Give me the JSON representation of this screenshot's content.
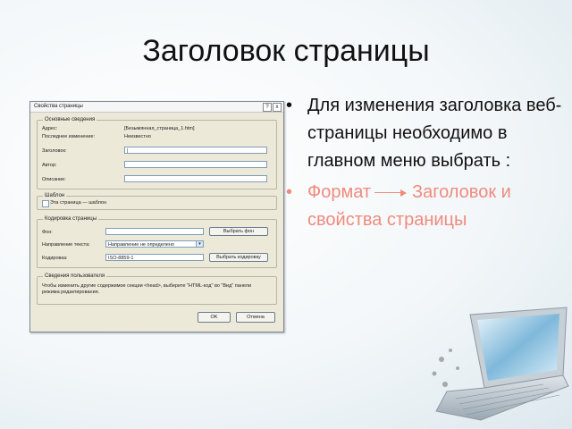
{
  "slide": {
    "title": "Заголовок страницы",
    "bullet1": "Для изменения заголовка веб-страницы необходимо в главном меню выбрать :",
    "bullet2_part1": "Формат",
    "bullet2_part2": "Заголовок и свойства страницы"
  },
  "dialog": {
    "title": "Свойства страницы",
    "help_button": "?",
    "close_button": "x",
    "group_general": {
      "label": "Основные сведения",
      "rows": [
        {
          "label": "Адрес:",
          "value": "[Безымянная_страница_1.htm]"
        },
        {
          "label": "Последнее изменение:",
          "value": "Неизвестно"
        },
        {
          "label": "Заголовок:",
          "value": "|"
        },
        {
          "label": "Автор:",
          "value": ""
        },
        {
          "label": "Описание:",
          "value": ""
        }
      ]
    },
    "group_template": {
      "label": "Шаблон",
      "checkbox_label": "Эта страница — шаблон"
    },
    "group_encoding": {
      "label": "Кодировка страницы",
      "rows": [
        {
          "label": "Фон:",
          "value": "",
          "button": "Выбрать фон"
        },
        {
          "label": "Направление текста:",
          "value": "Направление не определено",
          "button": ""
        },
        {
          "label": "Кодировка:",
          "value": "ISO-8859-1",
          "button": "Выбрать кодировку"
        }
      ]
    },
    "group_note": {
      "label": "Сведения пользователя",
      "text": "Чтобы изменить другие содержимое секции <head>, выберите \"HTML-код\" во \"Вид\" панели режима редактирования."
    },
    "ok_button": "OK",
    "cancel_button": "Отмена"
  },
  "colors": {
    "accent_text": "#f08a7e",
    "dialog_bg": "#ece9d8"
  }
}
